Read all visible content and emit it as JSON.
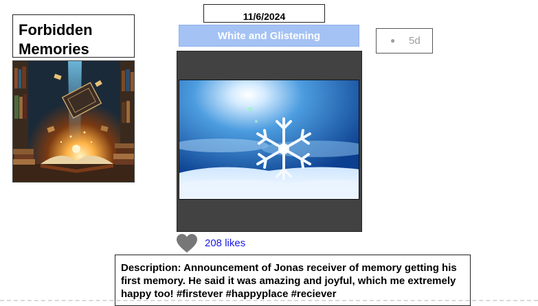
{
  "app": {
    "title": "Forbidden Memories"
  },
  "post": {
    "date": "11/6/2024",
    "title": "White and Glistening",
    "age": "5d",
    "likes": "208 likes",
    "description": "Description: Announcement of Jonas receiver of memory getting his first memory. He said it was amazing and joyful, which me extremely happy too!  #firstever #happyplace #reciever"
  },
  "icons": {
    "like": "heart-icon",
    "status": "dot-icon"
  },
  "colors": {
    "title_bar": "#a4c2f4",
    "frame": "#424242",
    "likes_text": "#1a1ae6",
    "age_text": "#9e9e9e"
  }
}
